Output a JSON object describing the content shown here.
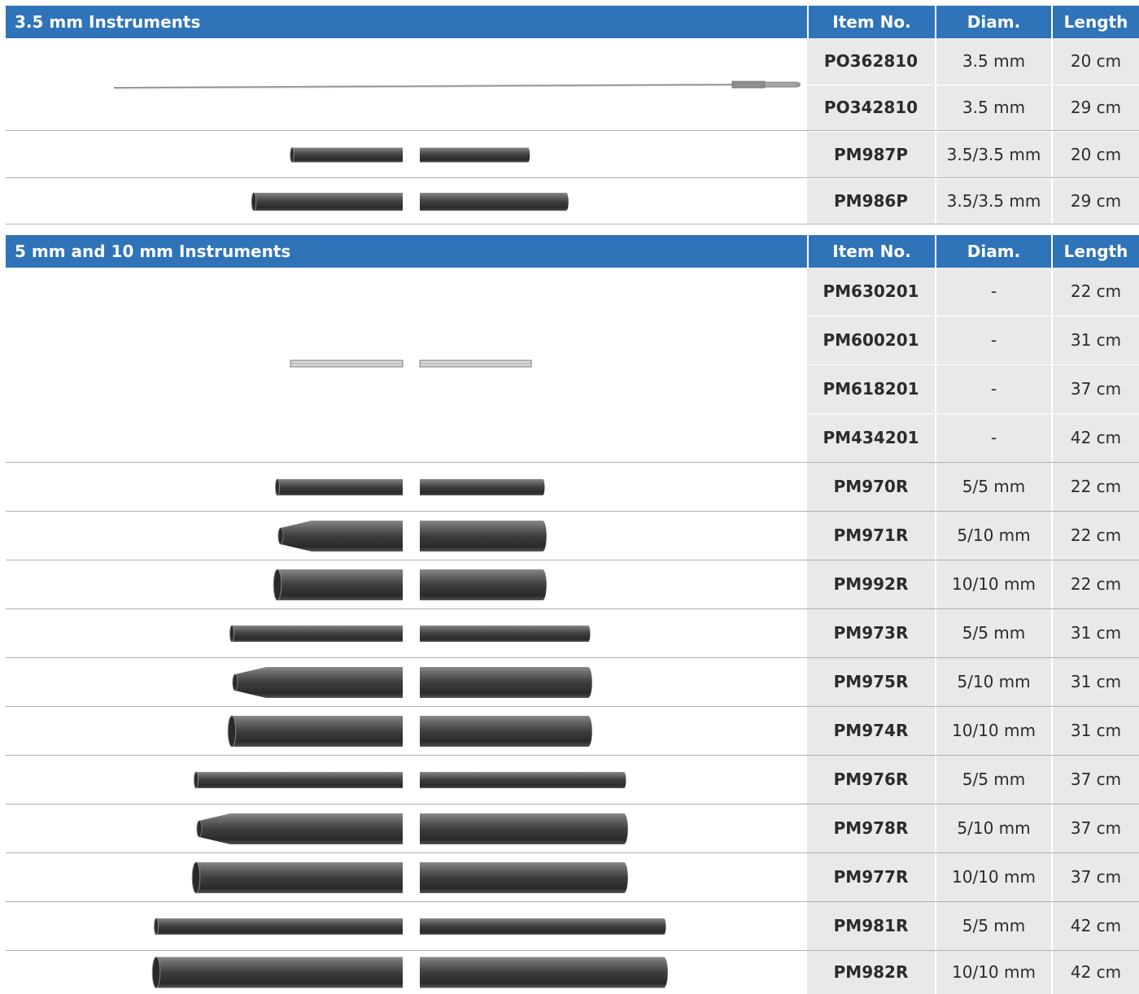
{
  "sections": [
    {
      "title": "3.5 mm Instruments",
      "col_item": "Item No.",
      "col_diam": "Diam.",
      "col_length": "Length",
      "rows": [
        {
          "item": "PO362810",
          "diam": "3.5 mm",
          "length": "20 cm"
        },
        {
          "item": "PO342810",
          "diam": "3.5 mm",
          "length": "29 cm"
        },
        {
          "item": "PM987P",
          "diam": "3.5/3.5 mm",
          "length": "20 cm"
        },
        {
          "item": "PM986P",
          "diam": "3.5/3.5 mm",
          "length": "29 cm"
        }
      ]
    },
    {
      "title": "5 mm and 10 mm Instruments",
      "col_item": "Item No.",
      "col_diam": "Diam.",
      "col_length": "Length",
      "rows": [
        {
          "item": "PM630201",
          "diam": "-",
          "length": "22 cm"
        },
        {
          "item": "PM600201",
          "diam": "-",
          "length": "31 cm"
        },
        {
          "item": "PM618201",
          "diam": "-",
          "length": "37 cm"
        },
        {
          "item": "PM434201",
          "diam": "-",
          "length": "42 cm"
        },
        {
          "item": "PM970R",
          "diam": "5/5 mm",
          "length": "22 cm"
        },
        {
          "item": "PM971R",
          "diam": "5/10 mm",
          "length": "22 cm"
        },
        {
          "item": "PM992R",
          "diam": "10/10 mm",
          "length": "22 cm"
        },
        {
          "item": "PM973R",
          "diam": "5/5 mm",
          "length": "31 cm"
        },
        {
          "item": "PM975R",
          "diam": "5/10 mm",
          "length": "31 cm"
        },
        {
          "item": "PM974R",
          "diam": "10/10 mm",
          "length": "31 cm"
        },
        {
          "item": "PM976R",
          "diam": "5/5 mm",
          "length": "37 cm"
        },
        {
          "item": "PM978R",
          "diam": "5/10 mm",
          "length": "37 cm"
        },
        {
          "item": "PM977R",
          "diam": "10/10 mm",
          "length": "37 cm"
        },
        {
          "item": "PM981R",
          "diam": "5/5 mm",
          "length": "42 cm"
        },
        {
          "item": "PM982R",
          "diam": "10/10 mm",
          "length": "42 cm"
        }
      ]
    }
  ],
  "colors": {
    "header_bg": "#2f73b9",
    "cell_bg": "#e9e9e9",
    "shaft": "#4a4a4a"
  }
}
